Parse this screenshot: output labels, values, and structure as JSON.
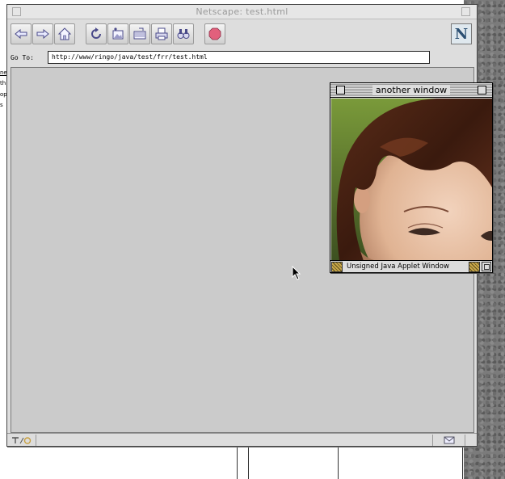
{
  "window": {
    "title": "Netscape: test.html"
  },
  "toolbar": {
    "buttons": [
      "back-icon",
      "forward-icon",
      "home-icon",
      "reload-icon",
      "images-icon",
      "open-icon",
      "print-icon",
      "find-icon",
      "stop-icon"
    ],
    "logo_letter": "N"
  },
  "location": {
    "label": "Go To:",
    "url": "http://www/ringo/java/test/frr/test.html"
  },
  "applet_window": {
    "title": "another window",
    "status": "Unsigned Java Applet Window"
  },
  "background_page": {
    "fragments": [
      "ne",
      "th",
      "op",
      "s"
    ]
  },
  "colors": {
    "content_bg": "#cbcbcb",
    "chrome": "#dddddd",
    "stop_button": "#e2607c"
  }
}
